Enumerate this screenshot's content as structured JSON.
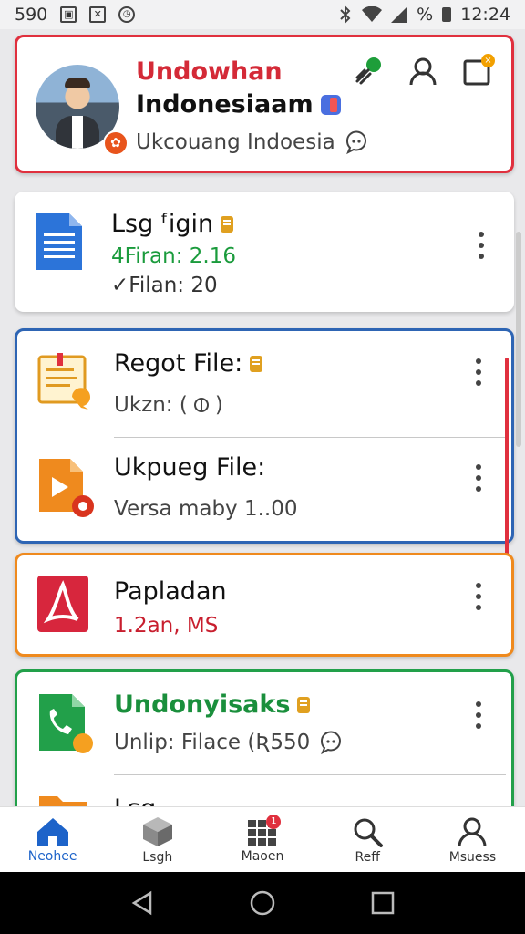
{
  "status_bar": {
    "left_text": "590",
    "left_icons": [
      "image-icon",
      "close-box-icon",
      "clock-icon"
    ],
    "battery_text": "%",
    "time": "12:24"
  },
  "profile": {
    "title": "Undowhan",
    "subtitle": "Indonesiaam",
    "location": "Ukcouang Indoesia",
    "actions": [
      "leaf-icon",
      "profile-icon",
      "notification-icon"
    ],
    "notification_badge": "×"
  },
  "files": [
    {
      "name": "Lsg ᶠigin",
      "line1": "4Firan: 2.16",
      "line2": "✓Filan: 20",
      "icon": "document-icon"
    },
    {
      "name": "Regot File:",
      "meta": "Ukzn: (",
      "icon": "note-icon"
    },
    {
      "name": "Ukpueg File:",
      "meta": "Versa maby 1..00",
      "icon": "video-icon"
    },
    {
      "name": "Papladan",
      "meta": "1.2an, MS",
      "icon": "pdf-icon"
    },
    {
      "name": "Undonyisaks",
      "meta": "Unlip: Filace (Ʀ550",
      "icon": "phone-file-icon"
    },
    {
      "name": "Lsg",
      "icon": "folder-icon"
    }
  ],
  "bottom_nav": [
    {
      "label": "Neohee",
      "icon": "home-icon",
      "active": true
    },
    {
      "label": "Lsgh",
      "icon": "box-icon"
    },
    {
      "label": "Maoen",
      "icon": "grid-icon",
      "badge": "1"
    },
    {
      "label": "Reff",
      "icon": "search-icon"
    },
    {
      "label": "Msuess",
      "icon": "person-icon"
    }
  ],
  "colors": {
    "profile_border": "#e0303e",
    "blue_border": "#2e65b4",
    "orange_border": "#ef8a1e",
    "green_border": "#22a04a",
    "active_nav": "#1d63c9"
  }
}
